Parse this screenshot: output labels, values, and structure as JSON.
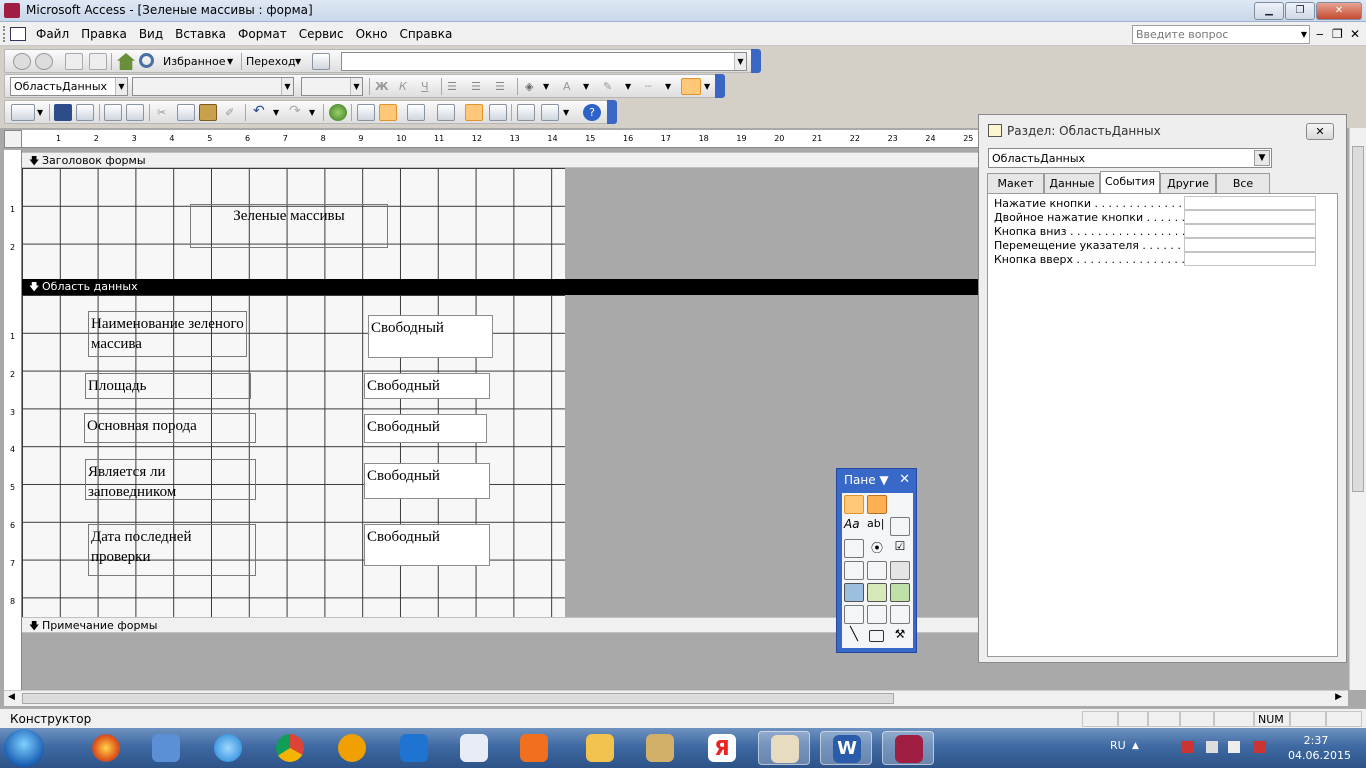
{
  "window": {
    "title": "Microsoft Access - [Зеленые массивы : форма]"
  },
  "menubar": {
    "items": [
      "Файл",
      "Правка",
      "Вид",
      "Вставка",
      "Формат",
      "Сервис",
      "Окно",
      "Справка"
    ],
    "help_placeholder": "Введите вопрос"
  },
  "toolbar_web": {
    "favorites": "Избранное",
    "goto": "Переход"
  },
  "toolbar_format": {
    "object_combo": "ОбластьДанных"
  },
  "form_design": {
    "header_section": "Заголовок формы",
    "detail_section": "Область данных",
    "footer_section": "Примечание формы",
    "form_title": "Зеленые массивы",
    "labels": [
      "Наименование зеленого массива",
      "Площадь",
      "Основная порода",
      "Является ли заповедником",
      "Дата последней проверки"
    ],
    "fields": [
      "Свободный",
      "Свободный",
      "Свободный",
      "Свободный",
      "Свободный"
    ],
    "ruler_top": [
      "1",
      "2",
      "3",
      "4",
      "5",
      "6",
      "7",
      "8",
      "9",
      "10",
      "11",
      "12",
      "13",
      "14",
      "15",
      "16",
      "17",
      "18",
      "19",
      "20",
      "21",
      "22",
      "23",
      "24",
      "25"
    ],
    "ruler_left_header": [
      "1",
      "2"
    ],
    "ruler_left_detail": [
      "1",
      "2",
      "3",
      "4",
      "5",
      "6",
      "7",
      "8"
    ]
  },
  "property_sheet": {
    "title": "Раздел: ОбластьДанных",
    "object": "ОбластьДанных",
    "tabs": [
      "Макет",
      "Данные",
      "События",
      "Другие",
      "Все"
    ],
    "active_tab": "События",
    "properties": [
      "Нажатие кнопки . . . . . . . . . . . . . .",
      "Двойное нажатие кнопки . . . . . . . .",
      "Кнопка вниз . . . . . . . . . . . . . . . . .",
      "Перемещение указателя . . . . . . . .",
      "Кнопка вверх . . . . . . . . . . . . . . . ."
    ]
  },
  "toolbox": {
    "title": "Пане"
  },
  "statusbar": {
    "text": "Конструктор",
    "num": "NUM"
  },
  "taskbar": {
    "lang": "RU",
    "time": "2:37",
    "date": "04.06.2015"
  },
  "colors": {
    "accent": "#3868c8",
    "active_tool": "#ffc878",
    "taskbar": "#3f6aa3"
  },
  "icons": {
    "toolbar": [
      "back-icon",
      "forward-icon",
      "stop-icon",
      "refresh-icon",
      "home-icon",
      "search-icon",
      "save-icon",
      "print-icon",
      "undo-icon",
      "redo-icon",
      "toolbox-icon",
      "properties-icon",
      "help-icon"
    ],
    "taskbar": [
      "firefox-icon",
      "volume-icon",
      "ie-icon",
      "chrome-icon",
      "mail-at-icon",
      "maxthon-icon",
      "envelope-icon",
      "media-player-icon",
      "folder-icon",
      "winrar-icon",
      "yandex-icon",
      "mahjong-icon",
      "word-icon",
      "access-icon"
    ]
  }
}
